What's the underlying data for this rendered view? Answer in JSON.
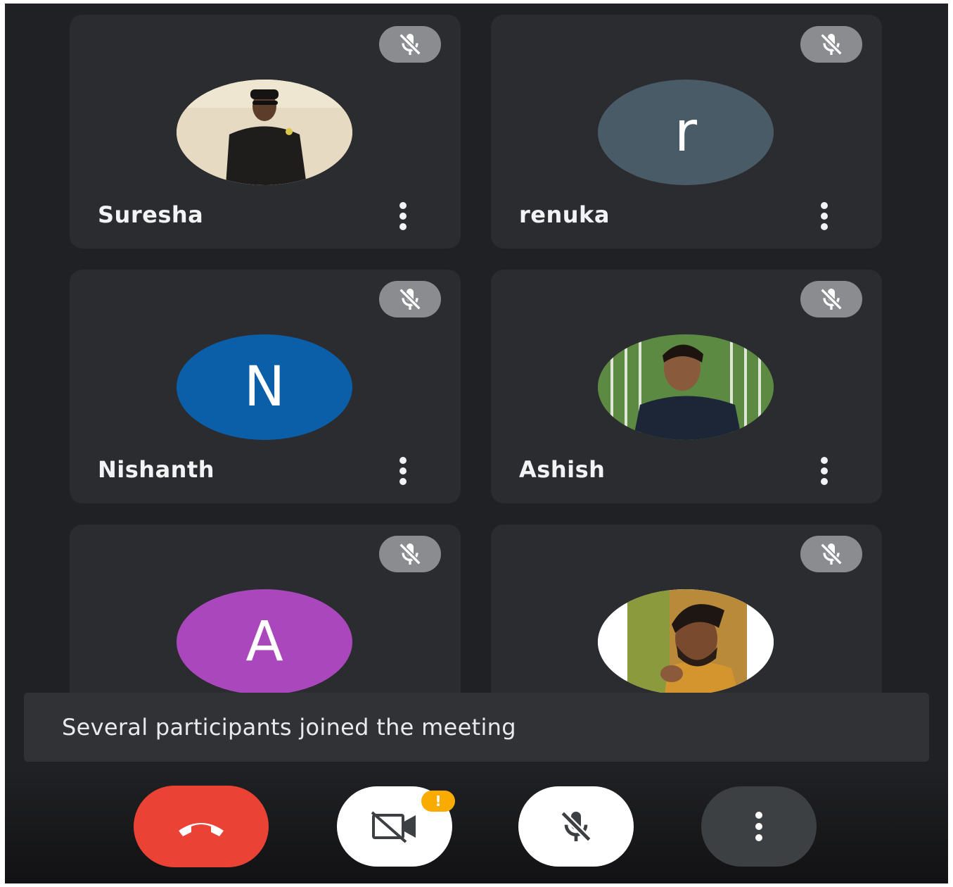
{
  "participants": [
    {
      "name": "Suresha",
      "initial": "",
      "avatar_type": "photo",
      "avatar_color": "#e9dfc6",
      "muted": true
    },
    {
      "name": "renuka",
      "initial": "r",
      "avatar_type": "letter",
      "avatar_color": "#4a5b68",
      "muted": true
    },
    {
      "name": "Nishanth",
      "initial": "N",
      "avatar_type": "letter",
      "avatar_color": "#0b5fa8",
      "muted": true
    },
    {
      "name": "Ashish",
      "initial": "",
      "avatar_type": "photo",
      "avatar_color": "#4d7a3a",
      "muted": true
    },
    {
      "name": "",
      "initial": "A",
      "avatar_type": "letter",
      "avatar_color": "#ab47bc",
      "muted": true
    },
    {
      "name": "",
      "initial": "",
      "avatar_type": "photo",
      "avatar_color": "#c89b4a",
      "muted": true
    }
  ],
  "toast": {
    "message": "Several participants joined the meeting"
  },
  "controls": {
    "end_call": {
      "icon": "phone-hangup-icon",
      "color": "#ea4335"
    },
    "camera": {
      "icon": "camera-off-icon",
      "warning_badge": "!",
      "warning_color": "#f9ab00"
    },
    "microphone": {
      "icon": "mic-off-icon"
    },
    "more": {
      "icon": "more-vert-icon"
    }
  },
  "colors": {
    "background": "#202124",
    "tile": "#2b2c30",
    "toast": "#313235",
    "muted_badge": "#8a8c90"
  }
}
